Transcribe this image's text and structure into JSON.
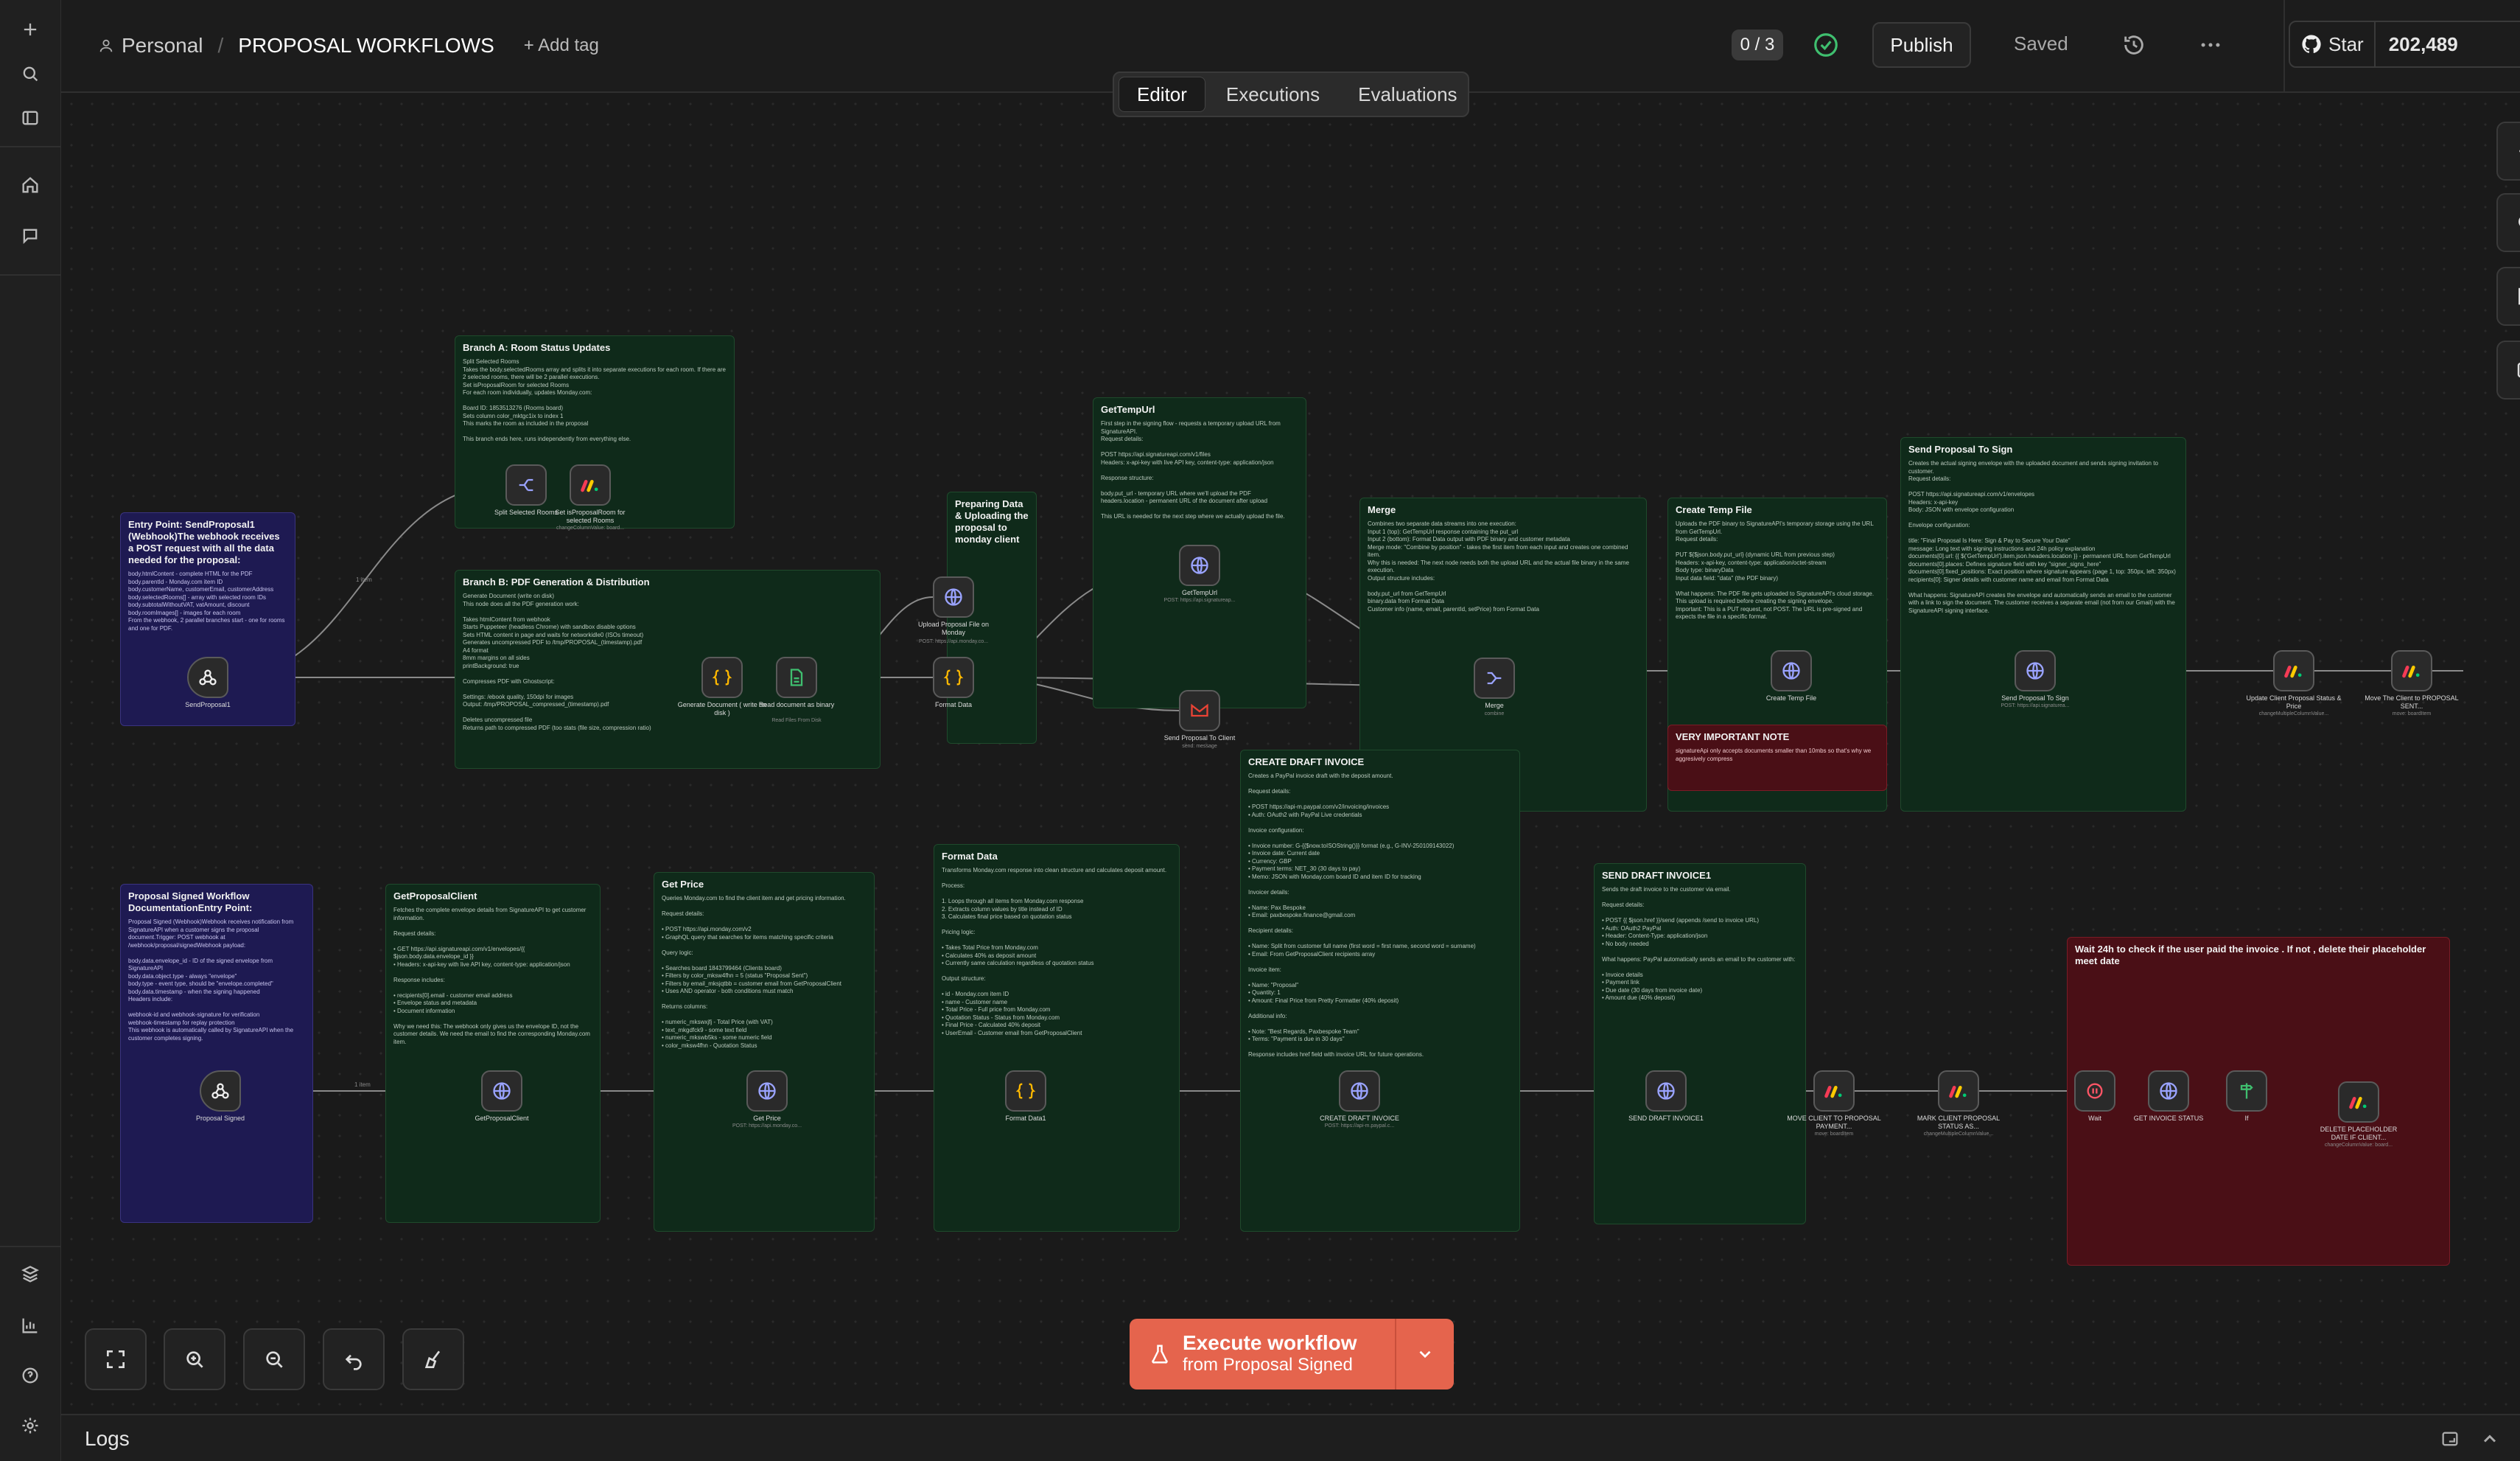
{
  "header": {
    "workspace": "Personal",
    "workflow_title": "PROPOSAL WORKFLOWS",
    "add_tag": "+ Add tag",
    "version_counter": "0 / 3",
    "publish": "Publish",
    "saved": "Saved",
    "star_label": "Star",
    "star_count": "202,489"
  },
  "tabs": [
    "Editor",
    "Executions",
    "Evaluations"
  ],
  "execute": {
    "title": "Execute workflow",
    "subtitle": "from Proposal Signed"
  },
  "logs_label": "Logs",
  "notes": {
    "entry": {
      "title": "Entry Point: SendProposal1 (Webhook)The webhook receives a POST request with all the data needed for the proposal:",
      "body": "body.htmlContent - complete HTML for the PDF\nbody.parentId - Monday.com item ID\nbody.customerName, customerEmail, customerAddress\nbody.selectedRooms[] - array with selected room IDs\nbody.subtotalWithoutVAT, vatAmount, discount\nbody.roomImages[] - images for each room\nFrom the webhook, 2 parallel branches start - one for rooms and one for PDF."
    },
    "branchA": {
      "title": "Branch A: Room Status Updates",
      "body": "Split Selected Rooms\nTakes the body.selectedRooms array and splits it into separate executions for each room. If there are 2 selected rooms, there will be 2 parallel executions.\nSet isProposalRoom for selected Rooms\nFor each room individually, updates Monday.com:\n\nBoard ID: 1853513276 (Rooms board)\nSets column color_mktgc1ix to index 1\nThis marks the room as included in the proposal\n\nThis branch ends here, runs independently from everything else."
    },
    "branchB": {
      "title": "Branch B: PDF Generation & Distribution",
      "body": "Generate Document (write on disk)\nThis node does all the PDF generation work:\n\nTakes htmlContent from webhook\nStarts Puppeteer (headless Chrome) with sandbox disable options\nSets HTML content in page and waits for networkidle0 (ISOs timeout)\nGenerates uncompressed PDF to /tmp/PROPOSAL_(timestamp).pdf\nA4 format\n8mm margins on all sides\nprintBackground: true\n\nCompresses PDF with Ghostscript:\n\nSettings: /ebook quality, 150dpi for images\nOutput: /tmp/PROPOSAL_compressed_(timestamp).pdf\n\nDeletes uncompressed file\nReturns path to compressed PDF (too stats (file size, compression ratio)"
    },
    "preparing": {
      "title": "Preparing Data & Uploading the proposal to monday client",
      "body": ""
    },
    "gettemp": {
      "title": "GetTempUrl",
      "body": "First step in the signing flow - requests a temporary upload URL from SignatureAPI.\nRequest details:\n\nPOST https://api.signatureapi.com/v1/files\nHeaders: x-api-key with live API key, content-type: application/json\n\nResponse structure:\n\nbody.put_url - temporary URL where we'll upload the PDF\nheaders.location - permanent URL of the document after upload\n\nThis URL is needed for the next step where we actually upload the file."
    },
    "merge": {
      "title": "Merge",
      "body": "Combines two separate data streams into one execution:\nInput 1 (top): GetTempUrl response containing the put_url\nInput 2 (bottom): Format Data output with PDF binary and customer metadata\nMerge mode: \"Combine by position\" - takes the first item from each input and creates one combined item.\nWhy this is needed: The next node needs both the upload URL and the actual file binary in the same execution.\nOutput structure includes:\n\nbody.put_url from GetTempUrl\nbinary.data from Format Data\nCustomer info (name, email, parentId, setPrice) from Format Data"
    },
    "createtemp": {
      "title": "Create Temp File",
      "body": "Uploads the PDF binary to SignatureAPI's temporary storage using the URL from GetTempUrl.\nRequest details:\n\nPUT ${$json.body.put_url} (dynamic URL from previous step)\nHeaders: x-api-key, content-type: application/octet-stream\nBody type: binaryData\nInput data field: \"data\" (the PDF binary)\n\nWhat happens: The PDF file gets uploaded to SignatureAPI's cloud storage. This upload is required before creating the signing envelope.\nImportant: This is a PUT request, not POST. The URL is pre-signed and expects the file in a specific format."
    },
    "sendsign": {
      "title": "Send Proposal To Sign",
      "body": "Creates the actual signing envelope with the uploaded document and sends signing invitation to customer.\nRequest details:\n\nPOST https://api.signatureapi.com/v1/envelopes\nHeaders: x-api-key\nBody: JSON with envelope configuration\n\nEnvelope configuration:\n\ntitle: \"Final Proposal Is Here: Sign & Pay to Secure Your Date\"\nmessage: Long text with signing instructions and 24h policy explanation\ndocuments[0].url: {{ $('GetTempUrl').item.json.headers.location }} - permanent URL from GetTempUrl\ndocuments[0].places: Defines signature field with key \"signer_signs_here\"\ndocuments[0].fixed_positions: Exact position where signature appears (page 1, top: 350px, left: 350px)\nrecipients[0]: Signer details with customer name and email from Format Data\n\nWhat happens: SignatureAPI creates the envelope and automatically sends an email to the customer with a link to sign the document. The customer receives a separate email (not from our Gmail) with the SignatureAPI signing interface."
    },
    "important": {
      "title": "VERY IMPORTANT NOTE",
      "body": "signatureApi only accepts documents smaller than 10mbs so that's why we aggresively compress"
    },
    "signed": {
      "title": "Proposal Signed Workflow DocumentationEntry Point:",
      "body": "Proposal Signed (Webhook)Webhook receives notification from SignatureAPI when a customer signs the proposal document.Trigger: POST webhook at /webhook/proposal/signedWebhook payload:\n\nbody.data.envelope_id - ID of the signed envelope from SignatureAPI\nbody.data.object.type - always \"envelope\"\nbody.type - event type, should be \"envelope.completed\"\nbody.data.timestamp - when the signing happened\nHeaders include:\n\nwebhook-id and webhook-signature for verification\nwebhook-timestamp for replay protection\nThis webhook is automatically called by SignatureAPI when the customer completes signing."
    },
    "getclient": {
      "title": "GetProposalClient",
      "body": "Fetches the complete envelope details from SignatureAPI to get customer information.\n\nRequest details:\n\n• GET https://api.signatureapi.com/v1/envelopes/{{ $json.body.data.envelope_id }}\n• Headers: x-api-key with live API key, content-type: application/json\n\nResponse includes:\n\n• recipients[0].email - customer email address\n• Envelope status and metadata\n• Document information\n\nWhy we need this: The webhook only gives us the envelope ID, not the customer details. We need the email to find the corresponding Monday.com item."
    },
    "getprice": {
      "title": "Get Price",
      "body": "Queries Monday.com to find the client item and get pricing information.\n\nRequest details:\n\n• POST https://api.monday.com/v2\n• GraphQL query that searches for items matching specific criteria\n\nQuery logic:\n\n• Searches board 1843799464 (Clients board)\n• Filters by color_mksw4fhn = 5 (status \"Proposal Sent\")\n• Filters by email_mksjqtbb = customer email from GetProposalClient\n• Uses AND operator - both conditions must match\n\nReturns columns:\n\n• numeric_mkswxjfj - Total Price (with VAT)\n• text_mkgdfck9 - some text field\n• numeric_mkswb5ks - some numeric field\n• color_mksw4fhn - Quotation Status"
    },
    "formatdata": {
      "title": "Format Data",
      "body": "Transforms Monday.com response into clean structure and calculates deposit amount.\n\nProcess:\n\n1. Loops through all items from Monday.com response\n2. Extracts column values by title instead of ID\n3. Calculates final price based on quotation status\n\nPricing logic:\n\n• Takes Total Price from Monday.com\n• Calculates 40% as deposit amount\n• Currently same calculation regardless of quotation status\n\nOutput structure:\n\n• id - Monday.com item ID\n• name - Customer name\n• Total Price - Full price from Monday.com\n• Quotation Status - Status from Monday.com\n• Final Price - Calculated 40% deposit\n• UserEmail - Customer email from GetProposalClient"
    },
    "draft": {
      "title": "CREATE DRAFT INVOICE",
      "body": "Creates a PayPal invoice draft with the deposit amount.\n\nRequest details:\n\n• POST https://api-m.paypal.com/v2/invoicing/invoices\n• Auth: OAuth2 with PayPal Live credentials\n\nInvoice configuration:\n\n• Invoice number: G-{{$now.toISOString()}} format (e.g., G-INV-250109143022)\n• Invoice date: Current date\n• Currency: GBP\n• Payment terms: NET_30 (30 days to pay)\n• Memo: JSON with Monday.com board ID and item ID for tracking\n\nInvoicer details:\n\n• Name: Pax Bespoke\n• Email: paxbespoke.finance@gmail.com\n\nRecipient details:\n\n• Name: Split from customer full name (first word = first name, second word = surname)\n• Email: From GetProposalClient recipients array\n\nInvoice item:\n\n• Name: \"Proposal\"\n• Quantity: 1\n• Amount: Final Price from Pretty Formatter (40% deposit)\n\nAdditional info:\n\n• Note: \"Best Regards, Paxbespoke Team\"\n• Terms: \"Payment is due in 30 days\"\n\nResponse includes href field with invoice URL for future operations."
    },
    "senddraft": {
      "title": "SEND DRAFT INVOICE1",
      "body": "Sends the draft invoice to the customer via email.\n\nRequest details:\n\n• POST {{ $json.href }}/send (appends /send to invoice URL)\n• Auth: OAuth2 PayPal\n• Header: Content-Type: application/json\n• No body needed\n\nWhat happens: PayPal automatically sends an email to the customer with:\n\n• Invoice details\n• Payment link\n• Due date (30 days from invoice date)\n• Amount due (40% deposit)"
    },
    "wait": {
      "title": "Wait 24h to check if the user paid the invoice . If not , delete their placeholder meet date",
      "body": ""
    }
  },
  "nodes": {
    "sendproposal": {
      "label": "SendProposal1",
      "sub": ""
    },
    "split": {
      "label": "Split Selected Rooms",
      "sub": ""
    },
    "setroom": {
      "label": "Set isProposalRoom for selected Rooms",
      "sub": "changeColumnValue: board..."
    },
    "gendoc": {
      "label": "Generate Document ( write on disk )",
      "sub": ""
    },
    "readdoc": {
      "label": "Read document as binary",
      "sub": "Read Files From Disk"
    },
    "upload": {
      "label": "Upload Proposal File on Monday",
      "sub": "POST: https://api.monday.co..."
    },
    "formatdata1": {
      "label": "Format Data",
      "sub": ""
    },
    "gettemp": {
      "label": "GetTempUrl",
      "sub": "POST: https://api.signatureap..."
    },
    "sendclient": {
      "label": "Send Proposal To Client",
      "sub": "send: message"
    },
    "merge": {
      "label": "Merge",
      "sub": "combine"
    },
    "createtemp": {
      "label": "Create Temp File",
      "sub": ""
    },
    "sendsign": {
      "label": "Send Proposal To Sign",
      "sub": "POST: https://api.signaturea..."
    },
    "updateclient": {
      "label": "Update Client Proposal Status & Price",
      "sub": "changeMultipleColumnValue..."
    },
    "moveclient": {
      "label": "Move The Client to PROPOSAL SENT...",
      "sub": "move: boardItem"
    },
    "signed": {
      "label": "Proposal Signed",
      "sub": ""
    },
    "getclient": {
      "label": "GetProposalClient",
      "sub": ""
    },
    "getprice": {
      "label": "Get Price",
      "sub": "POST: https://api.monday.co..."
    },
    "formatdata2": {
      "label": "Format Data1",
      "sub": ""
    },
    "draft": {
      "label": "CREATE DRAFT INVOICE",
      "sub": "POST: https://api-m.paypal.c..."
    },
    "senddraft": {
      "label": "SEND DRAFT INVOICE1",
      "sub": ""
    },
    "moveclient2": {
      "label": "MOVE CLIENT TO PROPOSAL PAYMENT...",
      "sub": "move: boardItem"
    },
    "markclient": {
      "label": "MARK CLIENT PROPOSAL STATUS AS...",
      "sub": "changeMultipleColumnValue..."
    },
    "wait": {
      "label": "Wait",
      "sub": ""
    },
    "getinvoice": {
      "label": "GET INVOICE STATUS",
      "sub": ""
    },
    "if": {
      "label": "If",
      "sub": ""
    },
    "deleteplaceholder": {
      "label": "DELETE PLACEHOLDER DATE IF CLIENT...",
      "sub": "changeColumnValue: board..."
    }
  },
  "edge_labels": {
    "one_item_a": "1 item",
    "one_item_b": "1 item"
  },
  "colors": {
    "accent": "#e5644d",
    "note_green": "#0f2a1a",
    "note_purple": "#1e1a52",
    "note_red": "#4a0f16",
    "success": "#3fbf6f"
  }
}
